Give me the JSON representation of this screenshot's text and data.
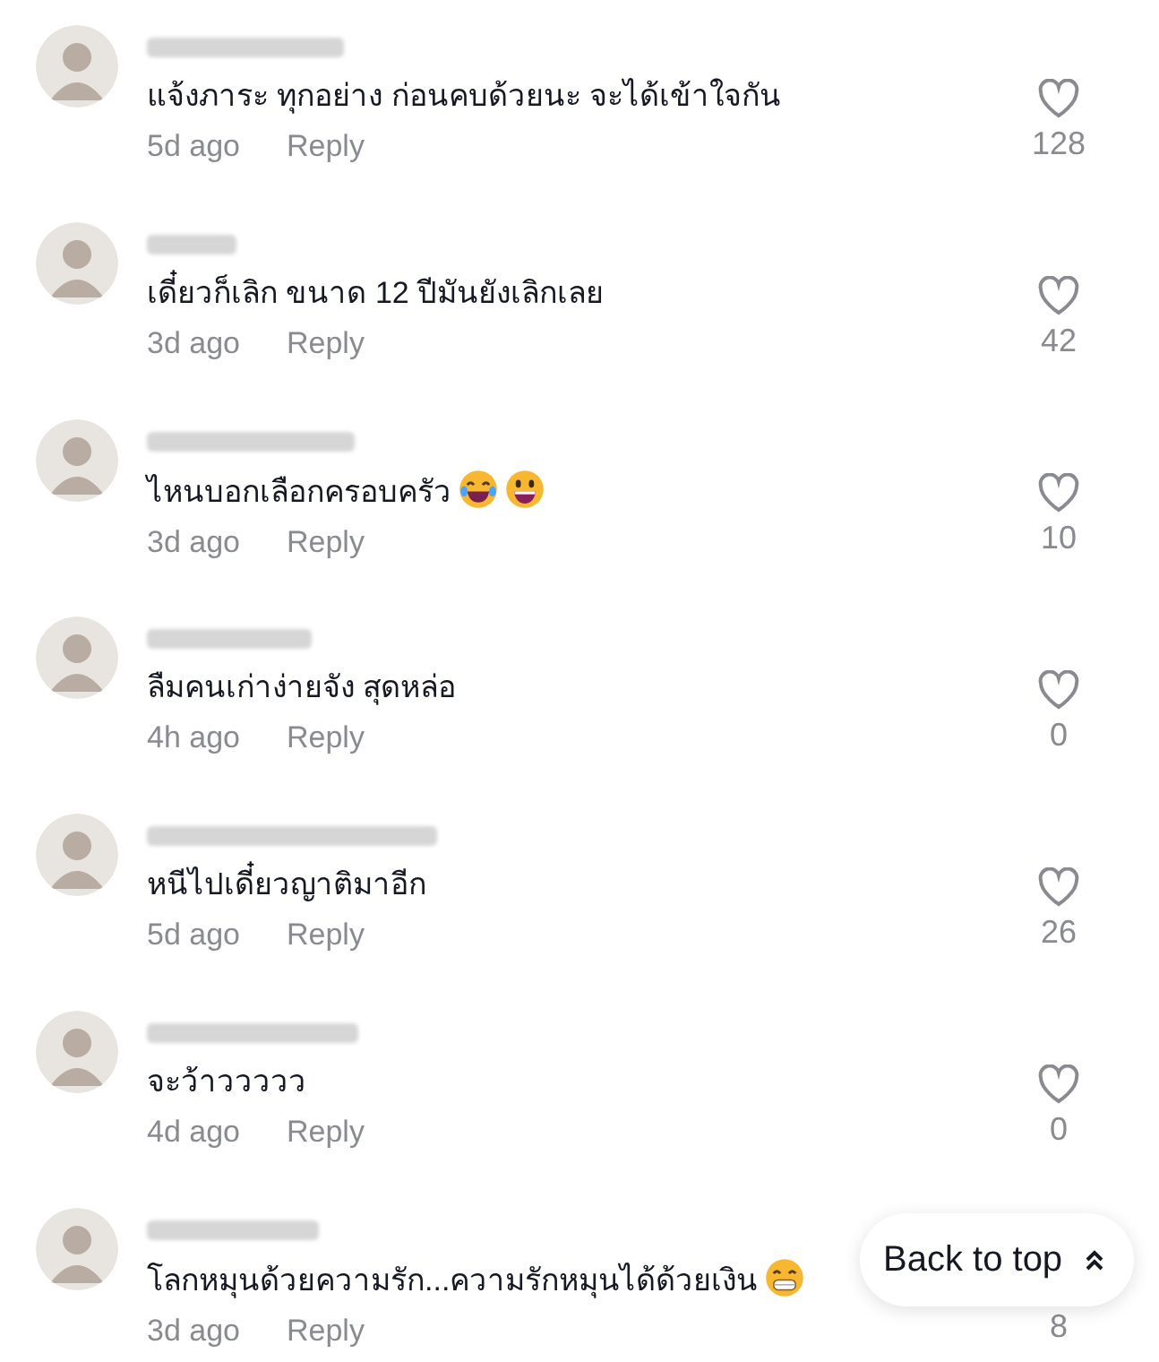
{
  "comments": [
    {
      "text": "แจ้งภาระ ทุกอย่าง ก่อนคบด้วยนะ จะได้เข้าใจกัน",
      "time": "5d ago",
      "reply": "Reply",
      "likes": "128"
    },
    {
      "text": "เดี๋ยวก็เลิก ขนาด 12 ปีมันยังเลิกเลย",
      "time": "3d ago",
      "reply": "Reply",
      "likes": "42"
    },
    {
      "text": "ไหนบอกเลือกครอบครัว",
      "emojis": [
        {
          "kind": "tears-of-joy"
        },
        {
          "kind": "grin"
        }
      ],
      "time": "3d ago",
      "reply": "Reply",
      "likes": "10"
    },
    {
      "text": "ลืมคนเก่าง่ายจัง สุดหล่อ",
      "time": "4h ago",
      "reply": "Reply",
      "likes": "0"
    },
    {
      "text": "หนีไปเดี๋ยวญาติมาอีก",
      "time": "5d ago",
      "reply": "Reply",
      "likes": "26"
    },
    {
      "text": "จะว้าววววว",
      "time": "4d ago",
      "reply": "Reply",
      "likes": "0"
    },
    {
      "text": "โลกหมุนด้วยความรัก...ความรักหมุนได้ด้วยเงิน",
      "emojis": [
        {
          "kind": "beaming"
        }
      ],
      "heart_covered": true,
      "time": "3d ago",
      "reply": "Reply",
      "likes": "8"
    }
  ],
  "back_to_top": {
    "label": "Back to top"
  }
}
